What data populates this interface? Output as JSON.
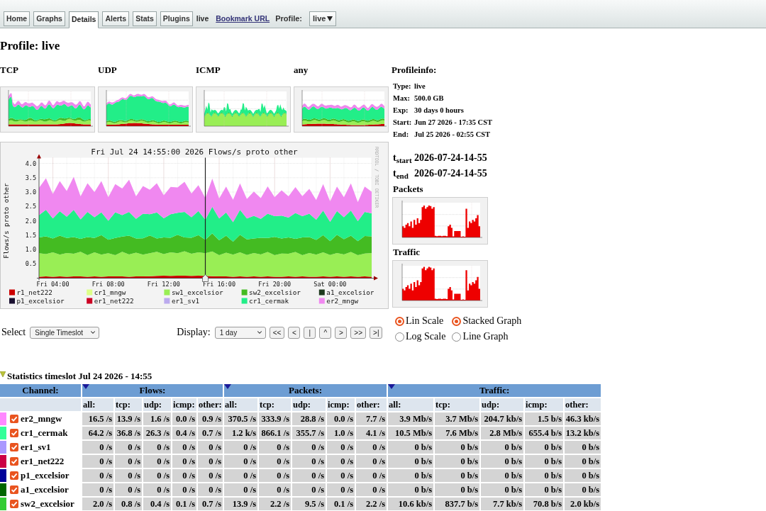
{
  "nav": {
    "tabs": [
      {
        "label": "Home",
        "selected": false
      },
      {
        "label": "Graphs",
        "selected": false
      },
      {
        "label": "Details",
        "selected": true
      },
      {
        "label": "Alerts",
        "selected": false
      },
      {
        "label": "Stats",
        "selected": false
      },
      {
        "label": "Plugins",
        "selected": false
      }
    ],
    "current_profile": "live",
    "bookmark_link": "Bookmark URL",
    "profile_label": "Profile:",
    "profile_select": "live"
  },
  "heading": "Profile: live",
  "protocol_graphs": [
    {
      "label": "TCP"
    },
    {
      "label": "UDP"
    },
    {
      "label": "ICMP"
    },
    {
      "label": "any"
    }
  ],
  "profile_info": {
    "title": "Profileinfo:",
    "rows": [
      {
        "label": "Type:",
        "value": "live"
      },
      {
        "label": "Max:",
        "value": "500.0 GB"
      },
      {
        "label": "Exp:",
        "value": "30 days 0 hours"
      },
      {
        "label": "Start:",
        "value": "Jun 27 2026 - 17:35 CST"
      },
      {
        "label": "End:",
        "value": "Jul 25 2026 - 02:55 CST"
      }
    ]
  },
  "timeslot": [
    {
      "label": "t$_{start}$",
      "value": "2026-07-24-14-55"
    },
    {
      "label": "t$_{end}$",
      "value": "2026-07-24-14-55"
    }
  ],
  "side_graphs": [
    {
      "title": "Packets"
    },
    {
      "title": "Traffic"
    }
  ],
  "main_graph": {
    "credit": "RRDTOOL / TOBI OETIKER",
    "legend": [
      {
        "kind": "series"
      },
      {
        "kind": "empty",
        "name": "cr1_mngw",
        "color": "#ddff88"
      },
      {
        "kind": "series"
      },
      {
        "kind": "series"
      },
      {
        "kind": "empty",
        "name": "a1_excelsior",
        "color": "#1e3a1e"
      },
      {
        "kind": "empty",
        "name": "p1_excelsior",
        "color": "#1a1030"
      },
      {
        "kind": "empty",
        "name": "er1_net222",
        "color": "#cc0022"
      },
      {
        "kind": "empty",
        "name": "er1_sv1",
        "color": "#bbaaee"
      },
      {
        "kind": "series"
      },
      {
        "kind": "series"
      }
    ],
    "chart_data": {
      "type": "area",
      "title": "Fri Jul 24 14:55:00 2026 Flows/s proto other",
      "ylabel": "Flows/s proto other",
      "stacked": true,
      "grid": true,
      "legend": "bottom",
      "categories": [
        null,
        null,
        "Fri 04:00",
        null,
        null,
        null,
        null,
        null,
        null,
        null,
        "Fri 08:00",
        null,
        null,
        null,
        null,
        null,
        null,
        null,
        "Fri 12:00",
        null,
        null,
        null,
        null,
        null,
        null,
        null,
        "Fri 16:00",
        null,
        null,
        null,
        null,
        null,
        null,
        null,
        "Fri 20:00",
        null,
        null,
        null,
        null,
        null,
        null,
        null,
        "Sat 00:00",
        null,
        null,
        null,
        null,
        null,
        null
      ],
      "ylim": [
        0,
        4
      ],
      "yticks": [
        {
          "value": 0.5,
          "label": "0.5"
        },
        {
          "value": 1,
          "label": "1.0"
        },
        {
          "value": 1.5,
          "label": "1.5"
        },
        {
          "value": 2,
          "label": "2.0"
        },
        {
          "value": 2.5,
          "label": "2.5"
        },
        {
          "value": 3,
          "label": "3.0"
        },
        {
          "value": 3.5,
          "label": "3.5"
        },
        {
          "value": 4,
          "label": "4.0"
        }
      ],
      "series": [
        {
          "name": "r1_net222",
          "color": "#cc0000",
          "values": [
            0.05,
            0.06,
            0.05,
            0.06,
            0.05,
            0.06,
            0.06,
            0.05,
            0.06,
            0.05,
            0.06,
            0.06,
            0.06,
            0.05,
            0.06,
            0.06,
            0.07,
            0.08,
            0.09,
            0.08,
            0.09,
            0.09,
            0.08,
            0.09,
            0.08,
            0.07,
            0.06,
            0.06,
            0.05,
            0.06,
            0.05,
            0.06,
            0.05,
            0.06,
            0.05,
            0.05,
            0.06,
            0.05,
            0.06,
            0.05,
            0.05,
            0.06,
            0.05,
            0.06,
            0.05,
            0.06,
            0.05,
            0.06,
            0.05
          ]
        },
        {
          "name": "sw1_excelsior",
          "color": "#99ee55",
          "values": [
            0.82,
            0.78,
            0.85,
            0.76,
            0.83,
            0.79,
            0.86,
            0.75,
            0.84,
            0.77,
            0.81,
            0.74,
            0.86,
            0.78,
            0.83,
            0.76,
            0.8,
            0.84,
            0.75,
            0.82,
            0.78,
            0.85,
            0.77,
            0.81,
            0.79,
            0.86,
            0.74,
            0.83,
            0.77,
            0.84,
            0.76,
            0.82,
            0.78,
            0.85,
            0.75,
            0.81,
            0.79,
            0.86,
            0.74,
            0.83,
            0.77,
            0.84,
            0.76,
            0.82,
            0.78,
            0.85,
            0.75,
            0.8,
            0.83
          ]
        },
        {
          "name": "sw2_excelsior",
          "color": "#44bb22",
          "values": [
            0.55,
            0.62,
            0.48,
            0.66,
            0.52,
            0.58,
            0.45,
            0.63,
            0.5,
            0.68,
            0.47,
            0.6,
            0.53,
            0.65,
            0.49,
            0.57,
            0.62,
            0.46,
            0.58,
            0.51,
            0.64,
            0.48,
            0.56,
            0.6,
            0.47,
            0.63,
            0.52,
            0.59,
            0.45,
            0.61,
            0.54,
            0.5,
            0.58,
            0.49,
            0.64,
            0.52,
            0.57,
            0.46,
            0.62,
            0.55,
            0.51,
            0.6,
            0.48,
            0.63,
            0.53,
            0.57,
            0.49,
            0.61,
            0.58
          ]
        },
        {
          "name": "cr1_cermak",
          "color": "#22ee88",
          "values": [
            0.78,
            0.92,
            0.7,
            0.85,
            0.74,
            0.95,
            0.68,
            0.88,
            0.72,
            0.8,
            0.66,
            0.9,
            0.75,
            0.83,
            0.69,
            0.86,
            0.74,
            0.91,
            0.67,
            0.82,
            0.77,
            0.89,
            0.71,
            0.84,
            0.7,
            0.93,
            0.76,
            0.81,
            0.68,
            0.87,
            0.73,
            0.79,
            0.66,
            0.85,
            0.72,
            0.8,
            0.69,
            0.9,
            0.74,
            0.82,
            0.71,
            0.86,
            0.67,
            0.83,
            0.76,
            0.88,
            0.7,
            0.84,
            0.8
          ]
        },
        {
          "name": "er2_mngw",
          "color": "#f088f0",
          "values": [
            0.95,
            1.1,
            0.85,
            1.05,
            0.9,
            1.15,
            0.8,
            1.0,
            0.88,
            1.08,
            0.82,
            0.98,
            0.92,
            1.12,
            0.78,
            0.96,
            0.85,
            1.02,
            0.8,
            0.95,
            0.88,
            1.05,
            0.83,
            0.9,
            0.75,
            0.98,
            0.7,
            0.9,
            0.78,
            0.92,
            0.68,
            0.85,
            0.72,
            0.95,
            0.66,
            0.88,
            0.74,
            0.9,
            0.7,
            0.86,
            0.68,
            0.92,
            0.72,
            0.85,
            0.7,
            0.94,
            0.66,
            0.88,
            0.75
          ]
        }
      ]
    }
  },
  "view_controls": {
    "select_label": "Select",
    "select_value": "Single Timeslot",
    "display_label": "Display:",
    "display_value": "1 day",
    "nav_buttons": [
      "<<",
      "<",
      "|",
      "^",
      ">",
      ">>",
      ">|"
    ]
  },
  "scale_options": [
    {
      "label": "Lin Scale",
      "selected": true
    },
    {
      "label": "Log Scale",
      "selected": false
    }
  ],
  "graph_options": [
    {
      "label": "Stacked Graph",
      "selected": true
    },
    {
      "label": "Line Graph",
      "selected": false
    }
  ],
  "statistics": {
    "title": "Statistics timeslot Jul 24 2026 - 14:55",
    "expanded": true
  },
  "table": {
    "channel_header": "Channel:",
    "groups": [
      {
        "label": "Flows:",
        "columns": [
          "all:",
          "tcp:",
          "udp:",
          "icmp:",
          "other:"
        ]
      },
      {
        "label": "Packets:",
        "columns": [
          "all:",
          "tcp:",
          "udp:",
          "icmp:",
          "other:"
        ]
      },
      {
        "label": "Traffic:",
        "columns": [
          "all:",
          "tcp:",
          "udp:",
          "icmp:",
          "other:"
        ]
      }
    ],
    "rows": [
      {
        "name": "er2_mngw",
        "color": "#ff88ff",
        "checked": true,
        "values": [
          "16.5 /s",
          "13.9 /s",
          "1.6 /s",
          "0.0 /s",
          "0.9 /s",
          "370.5 /s",
          "333.9 /s",
          "28.8 /s",
          "0.0 /s",
          "7.7 /s",
          "3.9 Mb/s",
          "3.7 Mb/s",
          "204.7 kb/s",
          "1.5 b/s",
          "46.3 kb/s"
        ]
      },
      {
        "name": "cr1_cermak",
        "color": "#33ff99",
        "checked": true,
        "values": [
          "64.2 /s",
          "36.8 /s",
          "26.3 /s",
          "0.4 /s",
          "0.7 /s",
          "1.2 k/s",
          "866.1 /s",
          "355.7 /s",
          "1.0 /s",
          "4.1 /s",
          "10.5 Mb/s",
          "7.6 Mb/s",
          "2.8 Mb/s",
          "655.4 b/s",
          "13.2 kb/s"
        ]
      },
      {
        "name": "er1_sv1",
        "color": "#aa99ff",
        "checked": true,
        "values": [
          "0 /s",
          "0 /s",
          "0 /s",
          "0 /s",
          "0 /s",
          "0 /s",
          "0 /s",
          "0 /s",
          "0 /s",
          "0 /s",
          "0 b/s",
          "0 b/s",
          "0 b/s",
          "0 b/s",
          "0 b/s"
        ]
      },
      {
        "name": "er1_net222",
        "color": "#cc0044",
        "checked": true,
        "values": [
          "0 /s",
          "0 /s",
          "0 /s",
          "0 /s",
          "0 /s",
          "0 /s",
          "0 /s",
          "0 /s",
          "0 /s",
          "0 /s",
          "0 b/s",
          "0 b/s",
          "0 b/s",
          "0 b/s",
          "0 b/s"
        ]
      },
      {
        "name": "p1_excelsior",
        "color": "#000099",
        "checked": true,
        "values": [
          "0 /s",
          "0 /s",
          "0 /s",
          "0 /s",
          "0 /s",
          "0 /s",
          "0 /s",
          "0 /s",
          "0 /s",
          "0 /s",
          "0 b/s",
          "0 b/s",
          "0 b/s",
          "0 b/s",
          "0 b/s"
        ]
      },
      {
        "name": "a1_excelsior",
        "color": "#006600",
        "checked": true,
        "values": [
          "0 /s",
          "0 /s",
          "0 /s",
          "0 /s",
          "0 /s",
          "0 /s",
          "0 /s",
          "0 /s",
          "0 /s",
          "0 /s",
          "0 b/s",
          "0 b/s",
          "0 b/s",
          "0 b/s",
          "0 b/s"
        ]
      },
      {
        "name": "sw2_excelsior",
        "color": "#33cc33",
        "checked": true,
        "values": [
          "2.0 /s",
          "0.8 /s",
          "0.4 /s",
          "0.1 /s",
          "0.7 /s",
          "13.9 /s",
          "2.2 /s",
          "9.5 /s",
          "0.1 /s",
          "2.2 /s",
          "10.6 kb/s",
          "837.7 b/s",
          "7.7 kb/s",
          "70.8 b/s",
          "2.0 kb/s"
        ]
      }
    ]
  }
}
